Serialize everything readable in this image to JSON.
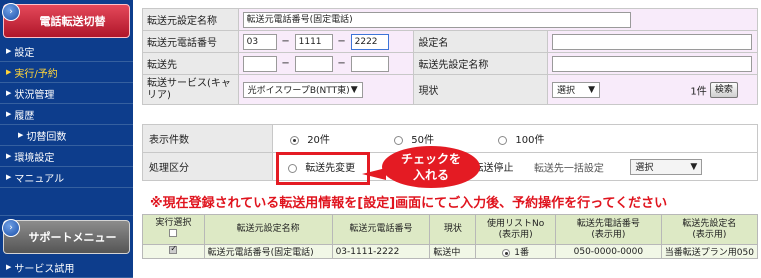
{
  "sidebar": {
    "header": "電話転送切替",
    "items": [
      {
        "label": "設定",
        "active": false,
        "sub": false
      },
      {
        "label": "実行/予約",
        "active": true,
        "sub": false
      },
      {
        "label": "状況管理",
        "active": false,
        "sub": false
      },
      {
        "label": "履歴",
        "active": false,
        "sub": false
      },
      {
        "label": "切替回数",
        "active": false,
        "sub": true
      },
      {
        "label": "環境設定",
        "active": false,
        "sub": false
      },
      {
        "label": "マニュアル",
        "active": false,
        "sub": false
      }
    ],
    "support_header": "サポートメニュー",
    "support_items": [
      {
        "label": "サービス試用"
      }
    ]
  },
  "form": {
    "source_setting_name_label": "転送元設定名称",
    "source_setting_name_value": "転送元電話番号(固定電話)",
    "source_phone_label": "転送元電話番号",
    "phone1": "03",
    "phone2": "1111",
    "phone3": "2222",
    "dash": "−",
    "setting_name_label": "設定名",
    "setting_name_value": "",
    "dest_label": "転送先",
    "dest_setting_name_label": "転送先設定名称",
    "dest_setting_name_value": "",
    "carrier_label": "転送サービス(キャリア)",
    "carrier_value": "光ボイスワープB(NTT東)",
    "status_label": "現状",
    "status_value": "選択",
    "count_text": "1件",
    "search_button": "検索"
  },
  "options": {
    "display_count_label": "表示件数",
    "display_count_options": [
      "20件",
      "50件",
      "100件"
    ],
    "display_count_selected": 0,
    "action_label": "処理区分",
    "action_option": "転送先変更",
    "stop_label": "転送停止",
    "bulk_label": "転送先一括設定",
    "bulk_select": "選択"
  },
  "notice": "※現在登録されている転送用情報を[設定]画面にてご入力後、予約操作を行ってください",
  "callout": "チェックを\n入れる",
  "table": {
    "headers": [
      "実行選択",
      "転送元設定名称",
      "転送元電話番号",
      "現状",
      "使用リストNo\n(表示用)",
      "転送先電話番号\n(表示用)",
      "転送先設定名\n(表示用)"
    ],
    "rows": [
      {
        "checked": true,
        "name": "転送元電話番号(固定電話)",
        "phone": "03-1111-2222",
        "status": "転送中",
        "list_no": "1番",
        "dest_phone": "050-0000-0000",
        "dest_name": "当番転送プラン用050"
      }
    ]
  },
  "colors": {
    "sidebar_bg": "#0d3d8c",
    "active_item": "#ffd43a",
    "accent_red": "#e41b23",
    "field_bg": "#f8ebfa",
    "table_header_bg": "#dde9c5"
  }
}
